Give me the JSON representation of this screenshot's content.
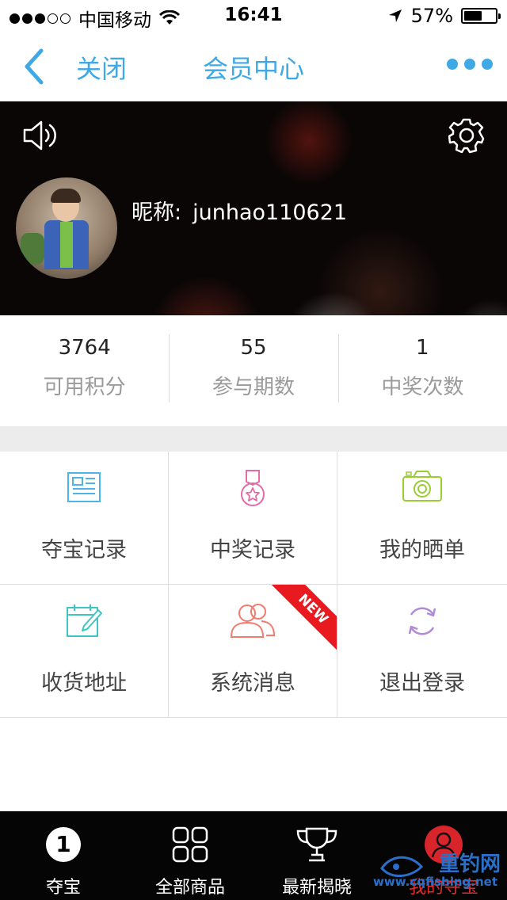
{
  "status_bar": {
    "carrier": "中国移动",
    "time": "16:41",
    "battery": "57%",
    "battery_level": 0.57
  },
  "nav": {
    "close_label": "关闭",
    "title": "会员中心"
  },
  "profile": {
    "nickname_label": "昵称:",
    "nickname": "junhao110621"
  },
  "stats": [
    {
      "value": "3764",
      "label": "可用积分"
    },
    {
      "value": "55",
      "label": "参与期数"
    },
    {
      "value": "1",
      "label": "中奖次数"
    }
  ],
  "menu": {
    "items": [
      {
        "label": "夺宝记录",
        "icon": "record-list-icon",
        "color": "#4fb3e8"
      },
      {
        "label": "中奖记录",
        "icon": "medal-icon",
        "color": "#e46aa9"
      },
      {
        "label": "我的晒单",
        "icon": "camera-icon",
        "color": "#9acd32"
      },
      {
        "label": "收货地址",
        "icon": "calendar-edit-icon",
        "color": "#3fc6c0"
      },
      {
        "label": "系统消息",
        "icon": "users-icon",
        "color": "#f07b6e"
      },
      {
        "label": "退出登录",
        "icon": "refresh-icon",
        "color": "#b08ad6"
      }
    ],
    "new_badge": "NEW"
  },
  "tabs": [
    {
      "label": "夺宝",
      "badge": "1"
    },
    {
      "label": "全部商品"
    },
    {
      "label": "最新揭晓"
    },
    {
      "label": "我的夺宝"
    }
  ],
  "watermark": {
    "brand": "重钓网",
    "url": "www.cqfishing.net"
  }
}
